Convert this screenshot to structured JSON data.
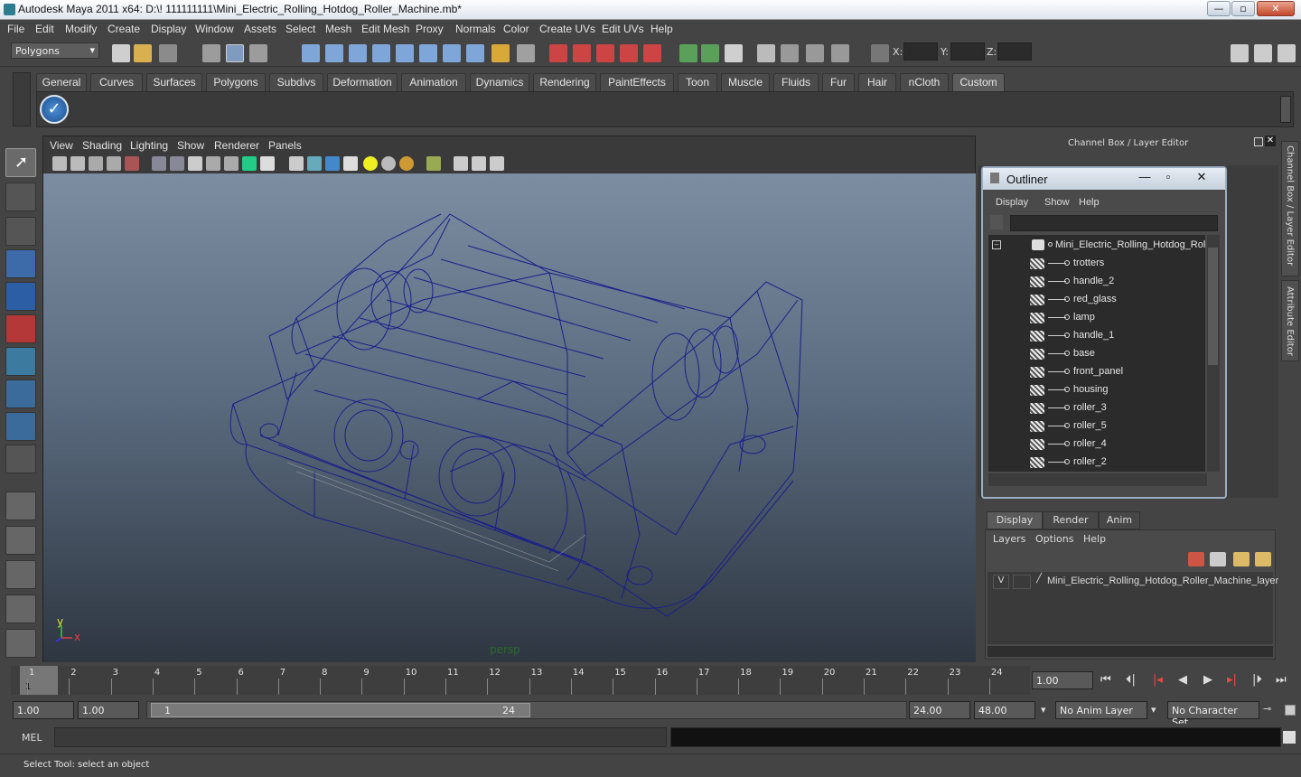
{
  "window": {
    "title": "Autodesk Maya 2011 x64: D:\\! 111111111\\Mini_Electric_Rolling_Hotdog_Roller_Machine.mb*",
    "min": "—",
    "max": "▫",
    "close": "✕"
  },
  "menubar": [
    "File",
    "Edit",
    "Modify",
    "Create",
    "Display",
    "Window",
    "Assets",
    "Select",
    "Mesh",
    "Edit Mesh",
    "Proxy",
    "Normals",
    "Color",
    "Create UVs",
    "Edit UVs",
    "Help"
  ],
  "status": {
    "mode_select": "Polygons",
    "x_label": "X:",
    "y_label": "Y:",
    "z_label": "Z:"
  },
  "shelf_tabs": [
    "General",
    "Curves",
    "Surfaces",
    "Polygons",
    "Subdivs",
    "Deformation",
    "Animation",
    "Dynamics",
    "Rendering",
    "PaintEffects",
    "Toon",
    "Muscle",
    "Fluids",
    "Fur",
    "Hair",
    "nCloth",
    "Custom"
  ],
  "shelf_active": "Custom",
  "viewport": {
    "menu": [
      "View",
      "Shading",
      "Lighting",
      "Show",
      "Renderer",
      "Panels"
    ],
    "camera_label": "persp",
    "axis_y": "y",
    "axis_x": "x"
  },
  "channel_box": {
    "title": "Channel Box / Layer Editor",
    "side_tab_1": "Channel Box / Layer Editor",
    "side_tab_2": "Attribute Editor"
  },
  "outliner": {
    "title": "Outliner",
    "menu": [
      "Display",
      "Show",
      "Help"
    ],
    "root": "Mini_Electric_Rolling_Hotdog_Rolle",
    "items": [
      "trotters",
      "handle_2",
      "red_glass",
      "lamp",
      "handle_1",
      "base",
      "front_panel",
      "housing",
      "roller_3",
      "roller_5",
      "roller_4",
      "roller_2"
    ]
  },
  "layer_editor": {
    "tabs": [
      "Display",
      "Render",
      "Anim"
    ],
    "menu": [
      "Layers",
      "Options",
      "Help"
    ],
    "layer_visible": "V",
    "layer_name": "Mini_Electric_Rolling_Hotdog_Roller_Machine_layer"
  },
  "timeline": {
    "ticks": [
      "1",
      "2",
      "3",
      "4",
      "5",
      "6",
      "7",
      "8",
      "9",
      "10",
      "11",
      "12",
      "13",
      "14",
      "15",
      "16",
      "17",
      "18",
      "19",
      "20",
      "21",
      "22",
      "23",
      "24"
    ],
    "current_frame_marker": "1",
    "current_time": "1.00"
  },
  "range": {
    "start_time": "1.00",
    "playback_start": "1.00",
    "slider_start": "1",
    "slider_end": "24",
    "playback_end": "24.00",
    "end_time": "48.00",
    "anim_layer": "No Anim Layer",
    "character_set": "No Character Set"
  },
  "mel": {
    "label": "MEL"
  },
  "help_line": "Select Tool: select an object"
}
